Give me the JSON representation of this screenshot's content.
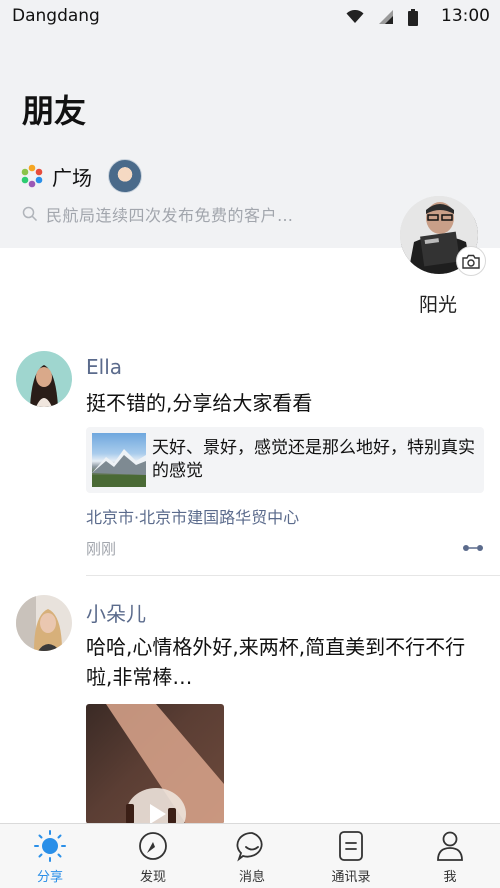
{
  "status_bar": {
    "app_name": "Dangdang",
    "time": "13:00"
  },
  "header": {
    "title": "朋友",
    "plaza_label": "广场",
    "search_placeholder": "民航局连续四次发布免费的客户…"
  },
  "profile": {
    "name": "阳光"
  },
  "posts": [
    {
      "author": "Ella",
      "text": "挺不错的,分享给大家看看",
      "link_card": {
        "text": "天好、景好，感觉还是那么地好，特别真实的感觉"
      },
      "location": "北京市·北京市建国路华贸中心",
      "time": "刚刚"
    },
    {
      "author": "小朵儿",
      "text": "哈哈,心情格外好,来两杯,简直美到不行不行啦,非常棒…"
    }
  ],
  "tabs": [
    {
      "label": "分享",
      "icon": "sun-icon",
      "active": true
    },
    {
      "label": "发现",
      "icon": "compass-icon",
      "active": false
    },
    {
      "label": "消息",
      "icon": "chat-bubble-icon",
      "active": false
    },
    {
      "label": "通讯录",
      "icon": "contacts-icon",
      "active": false
    },
    {
      "label": "我",
      "icon": "person-icon",
      "active": false
    }
  ],
  "colors": {
    "accent": "#2a8fe8",
    "name_blue": "#5b6b8c",
    "muted": "#a2a6ad"
  }
}
